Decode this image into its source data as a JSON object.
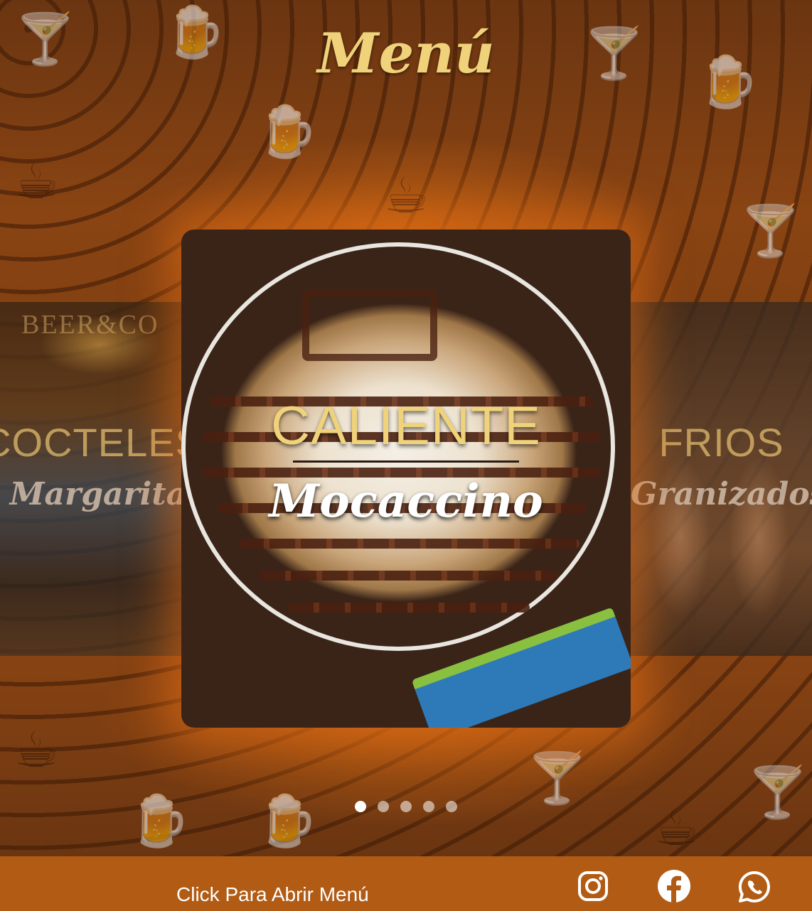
{
  "header": {
    "title": "Menú"
  },
  "carousel": {
    "slides": [
      {
        "category": "COCTELES",
        "item": "Margarita",
        "sign": "BEER&CO"
      },
      {
        "category": "CALIENTE",
        "item": "Mocaccino"
      },
      {
        "category": "FRIOS",
        "item": "Granizados"
      }
    ],
    "active_index": 1,
    "dots_count": 5,
    "active_dot": 0
  },
  "footer": {
    "cta_label": "Click Para Abrir Menú",
    "social": [
      "instagram-icon",
      "facebook-icon",
      "whatsapp-icon"
    ]
  },
  "colors": {
    "title": "#f0d27a",
    "footer_bg": "#b15b14",
    "glow": "#e66e14"
  }
}
